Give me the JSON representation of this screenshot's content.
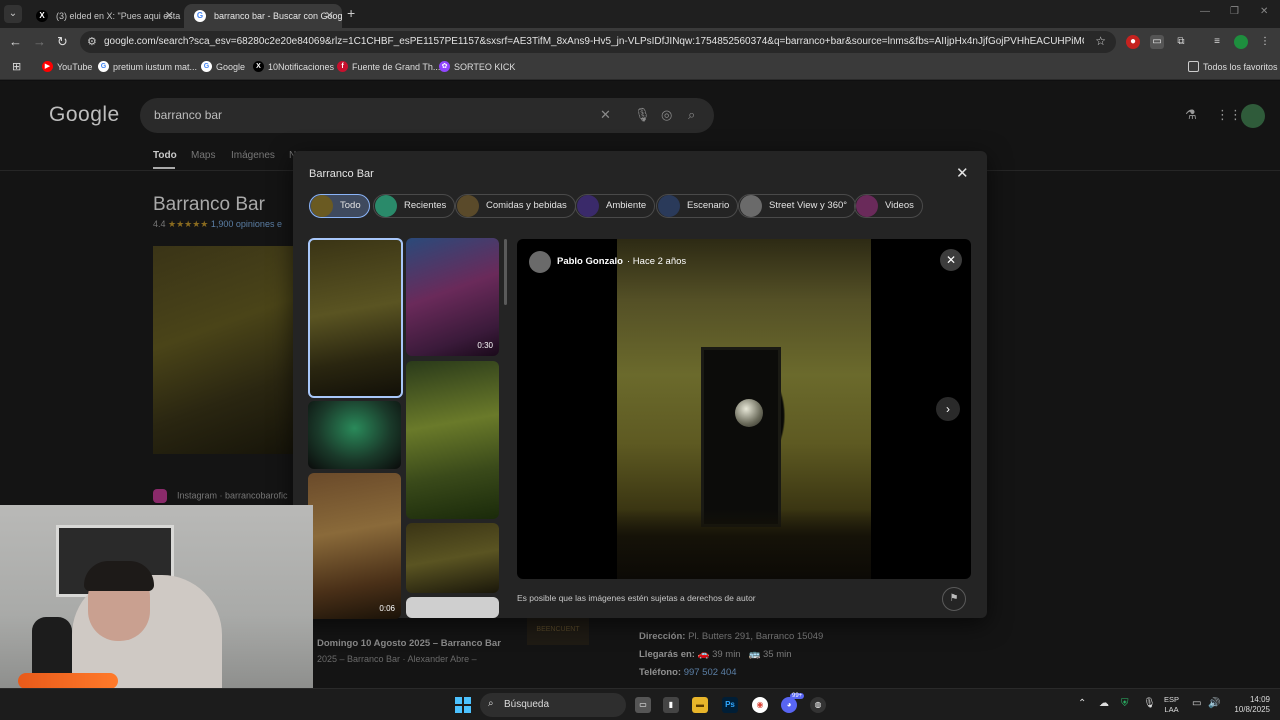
{
  "tabs": [
    {
      "title": "(3) elded en X: \"Pues aqui esta el",
      "favicon": "X"
    },
    {
      "title": "barranco bar - Buscar con Google",
      "favicon": "G"
    }
  ],
  "address": {
    "url": "google.com/search?sca_esv=68280c2e20e84069&rlz=1C1CHBF_esPE1157PE1157&sxsrf=AE3TifM_8xAns9-Hv5_jn-VLPsIDfJINqw:1754852560374&q=barranco+bar&source=lnms&fbs=AIIjpHx4nJjfGojPVHhEACUHPiMQ888Yp7kQAgn2suU..."
  },
  "bookmarks": [
    {
      "label": "YouTube",
      "color": "#ff0000",
      "glyph": "▶"
    },
    {
      "label": "pretium iustum mat...",
      "color": "#4285f4",
      "glyph": "G"
    },
    {
      "label": "Google",
      "color": "#4285f4",
      "glyph": "G"
    },
    {
      "label": "10Notificaciones",
      "color": "#000000",
      "glyph": "X"
    },
    {
      "label": "Fuente de Grand Th...",
      "color": "#c8102e",
      "glyph": "f"
    },
    {
      "label": "SORTEO KICK",
      "color": "#9146ff",
      "glyph": "✿"
    }
  ],
  "bookmarks_all": "Todos los favoritos",
  "google": {
    "logo": "Google",
    "query": "barranco bar",
    "tabs": [
      "Todo",
      "Maps",
      "Imágenes",
      "N"
    ],
    "kp_title": "Barranco Bar",
    "rating": "4.4",
    "stars": "★★★★★",
    "reviews": "1,900 opiniones e",
    "instagram": "Instagram · barrancobarofic",
    "address_label": "Dirección:",
    "address_value": "Pl. Butters 291, Barranco 15049",
    "arrive_label": "Llegarás en:",
    "arrive_car": "🚗 39 min",
    "arrive_bus": "🚌 35 min",
    "phone_label": "Teléfono:",
    "phone_value": "997 502 404",
    "event_title": "Domingo 10 Agosto 2025 – Barranco Bar",
    "event_sub": "2025 – Barranco Bar · Alexander Abre –",
    "event_img": "BEENCUENT"
  },
  "modal": {
    "title": "Barranco Bar",
    "chips": [
      "Todo",
      "Recientes",
      "Comidas y bebidas",
      "Ambiente",
      "Escenario",
      "Street View y 360°",
      "Videos"
    ],
    "author": "Pablo Gonzalo",
    "time": "· Hace 2 años",
    "copyright": "Es posible que las imágenes estén sujetas a derechos de autor",
    "thumb_durations": [
      "0:30",
      "0:06"
    ]
  },
  "taskbar": {
    "search": "Búsqueda",
    "lang1": "ESP",
    "lang2": "LAA",
    "time": "14:09",
    "date": "10/8/2025",
    "badge": "99+"
  }
}
